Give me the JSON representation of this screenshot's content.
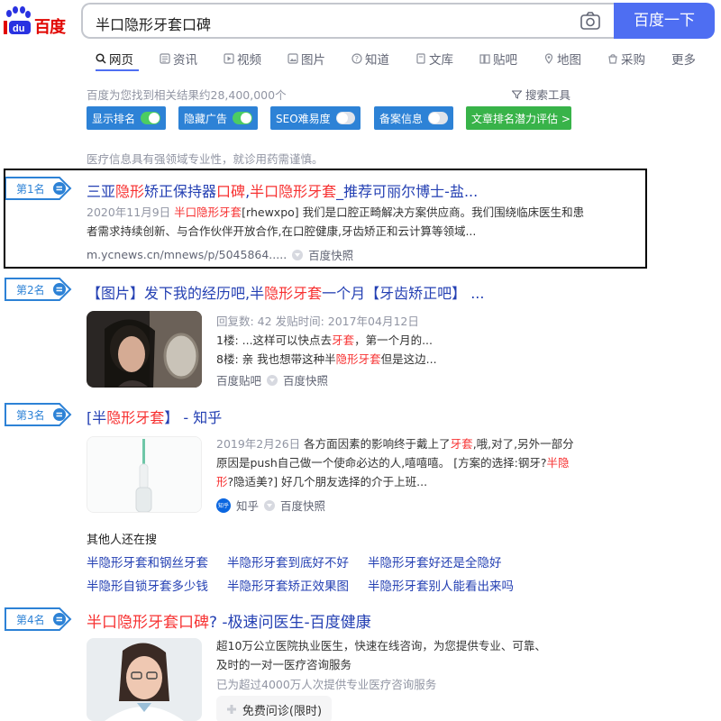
{
  "header": {
    "logo_text": "百度",
    "query": "半口隐形牙套口碑",
    "search_button": "百度一下"
  },
  "tabs": [
    {
      "label": "网页",
      "icon": "search-icon"
    },
    {
      "label": "资讯",
      "icon": "news-icon"
    },
    {
      "label": "视频",
      "icon": "video-icon"
    },
    {
      "label": "图片",
      "icon": "image-icon"
    },
    {
      "label": "知道",
      "icon": "question-icon"
    },
    {
      "label": "文库",
      "icon": "doc-icon"
    },
    {
      "label": "贴吧",
      "icon": "tieba-icon"
    },
    {
      "label": "地图",
      "icon": "map-icon"
    },
    {
      "label": "采购",
      "icon": "shop-icon"
    },
    {
      "label": "更多",
      "icon": ""
    }
  ],
  "result_count": "百度为您找到相关结果约28,400,000个",
  "search_tools": "搜索工具",
  "plugins": {
    "show_rank": "显示排名",
    "hide_ads": "隐藏广告",
    "seo": "SEO难易度",
    "icp": "备案信息",
    "potential": "文章排名潜力评估 >"
  },
  "notice": "医疗信息具有强领域专业性，就诊用药需谨慎。",
  "results": [
    {
      "rank": "第1名",
      "title_parts": [
        "三亚",
        "隐形",
        "矫正保持器",
        "口碑",
        ",",
        "半口隐形牙套",
        "_推荐可丽尔博士-盐..."
      ],
      "date": "2020年11月9日",
      "snippet_em": "半口隐形牙套",
      "snippet_1": "[rhewxpo] 我们是口腔正畸解决方案供应商。我们围绕临床医生和患",
      "snippet_2": "者需求持续创新、与合作伙伴开放合作,在口腔健康,牙齿矫正和云计算等领域...",
      "url": "m.ycnews.cn/mnews/p/5045864.....",
      "cache": "百度快照"
    },
    {
      "rank": "第2名",
      "title_parts": [
        "【图片】发下我的经历吧,半",
        "隐形牙套",
        "一个月【牙齿矫正吧】 ..."
      ],
      "line1": "回复数: 42 发贴时间: 2017年04月12日",
      "line2a": "1楼: ...这样可以快点去",
      "line2em": "牙套",
      "line2b": "，第一个月的...",
      "line3a": "8楼: 亲 我也想带这种半",
      "line3em": "隐形牙套",
      "line3b": "但是这边...",
      "source": "百度贴吧",
      "cache": "百度快照"
    },
    {
      "rank": "第3名",
      "title_parts": [
        "[半",
        "隐形牙套",
        "】 - 知乎"
      ],
      "date": "2019年2月26日",
      "s1a": "各方面因素的影响终于戴上了",
      "s1em": "牙套",
      "s1b": ",哦,对了,另外一部分",
      "s2a": "原因是push自己做一个使命必达的人,嘻嘻嘻。 [方案的选择:钢牙?",
      "s2em": "半隐",
      "s3em": "形",
      "s3b": "?隐适美?] 好几个朋友选择的介于上班...",
      "source": "知乎",
      "source_icon": "知乎",
      "cache": "百度快照"
    },
    {
      "rank": "第4名",
      "title_em": "半口隐形牙套口碑",
      "title_rest": "? -极速问医生-百度健康",
      "l1": "超10万公立医院执业医生，快速在线咨询，为您提供专业、可靠、",
      "l2": "及时的一对一医疗咨询服务",
      "l3": "已为超过4000万人次提供专业医疗咨询服务",
      "button": "免费问诊(限时)"
    }
  ],
  "related": {
    "heading": "其他人还在搜",
    "items": [
      "半隐形牙套和钢丝牙套",
      "半隐形牙套到底好不好",
      "半隐形牙套好还是全隐好",
      "半隐形自锁牙套多少钱",
      "半隐形牙套矫正效果图",
      "半隐形牙套别人能看出来吗"
    ]
  },
  "colors": {
    "brand_blue": "#4e6ef2",
    "link": "#2440b3",
    "highlight": "#f73131",
    "plugin_blue": "#2d82d6",
    "plugin_green": "#38b349"
  }
}
